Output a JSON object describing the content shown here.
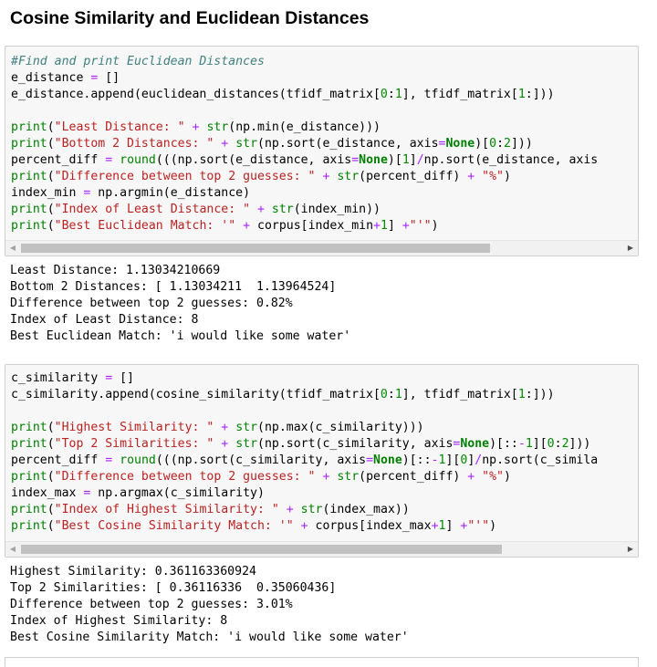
{
  "page": {
    "title": "Cosine Similarity and Euclidean Distances"
  },
  "cell1": {
    "code_lines": [
      "#Find and print Euclidean Distances",
      "e_distance = []",
      "e_distance.append(euclidean_distances(tfidf_matrix[0:1], tfidf_matrix[1:]))",
      "",
      "print(\"Least Distance: \" + str(np.min(e_distance)))",
      "print(\"Bottom 2 Distances: \" + str(np.sort(e_distance, axis=None)[0:2]))",
      "percent_diff = round(((np.sort(e_distance, axis=None)[1]/np.sort(e_distance, axis",
      "print(\"Difference between top 2 guesses: \" + str(percent_diff) + \"%\")",
      "index_min = np.argmin(e_distance)",
      "print(\"Index of Least Distance: \" + str(index_min))",
      "print(\"Best Euclidean Match: '\" + corpus[index_min+1] +\"'\")"
    ],
    "output_lines": [
      "Least Distance: 1.13034210669",
      "Bottom 2 Distances: [ 1.13034211  1.13964524]",
      "Difference between top 2 guesses: 0.82%",
      "Index of Least Distance: 8",
      "Best Euclidean Match: 'i would like some water'"
    ],
    "scroll_fraction": 0.78
  },
  "cell2": {
    "code_lines": [
      "c_similarity = []",
      "c_similarity.append(cosine_similarity(tfidf_matrix[0:1], tfidf_matrix[1:]))",
      "",
      "print(\"Highest Similarity: \" + str(np.max(c_similarity)))",
      "print(\"Top 2 Similarities: \" + str(np.sort(c_similarity, axis=None)[::-1][0:2]))",
      "percent_diff = round(((np.sort(c_similarity, axis=None)[::-1][0]/np.sort(c_simila",
      "print(\"Difference between top 2 guesses: \" + str(percent_diff) + \"%\")",
      "index_max = np.argmax(c_similarity)",
      "print(\"Index of Highest Similarity: \" + str(index_max))",
      "print(\"Best Cosine Similarity Match: '\" + corpus[index_max+1] +\"'\")"
    ],
    "output_lines": [
      "Highest Similarity: 0.361163360924",
      "Top 2 Similarities: [ 0.36116336  0.35060436]",
      "Difference between top 2 guesses: 3.01%",
      "Index of Highest Similarity: 8",
      "Best Cosine Similarity Match: 'i would like some water'"
    ],
    "scroll_fraction": 0.8
  },
  "icons": {
    "scroll_left": "triangle-left-icon",
    "scroll_right": "triangle-right-icon"
  },
  "colors": {
    "cell_background": "#f7f7f7",
    "comment": "#408080",
    "string": "#ba2121",
    "builtin": "#008000",
    "operator": "#aa22ff"
  }
}
